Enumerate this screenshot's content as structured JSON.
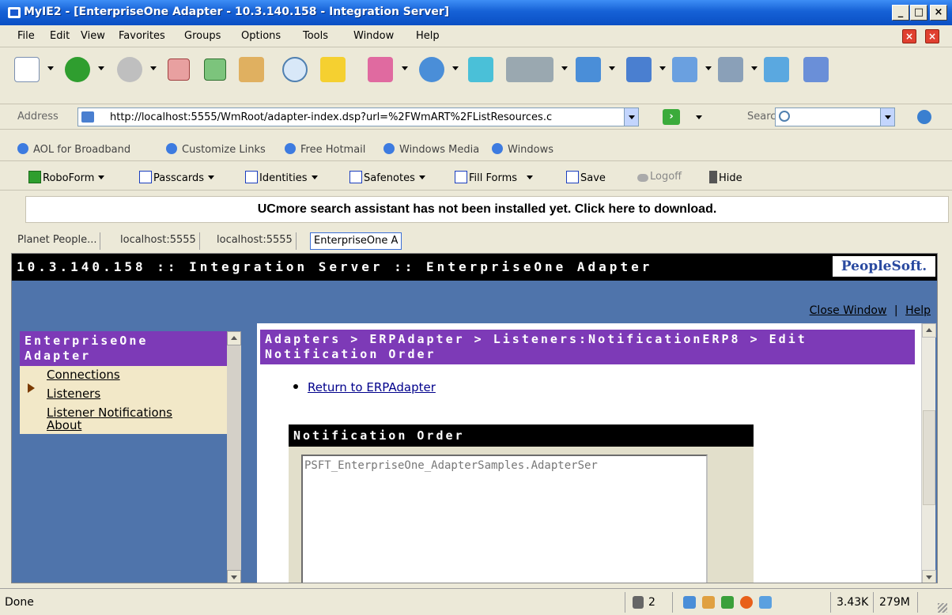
{
  "window": {
    "title": "MyIE2 - [EnterpriseOne Adapter - 10.3.140.158 - Integration Server]",
    "controls": [
      "_",
      "□",
      "×"
    ]
  },
  "menu": {
    "items": [
      "File",
      "Edit",
      "View",
      "Favorites",
      "Groups",
      "Options",
      "Tools",
      "Window",
      "Help"
    ]
  },
  "address": {
    "label": "Address",
    "url": "http://localhost:5555/WmRoot/adapter-index.dsp?url=%2FWmART%2FListResources.c"
  },
  "search": {
    "label": "Search"
  },
  "links": [
    "AOL for Broadband",
    "Customize Links",
    "Free Hotmail",
    "Windows Media",
    "Windows"
  ],
  "roboform": {
    "items": [
      "RoboForm",
      "Passcards",
      "Identities",
      "Safenotes",
      "Fill Forms",
      "Save",
      "Logoff",
      "Hide"
    ]
  },
  "ucmore": {
    "text": "UCmore search assistant has not been installed yet. Click here to download."
  },
  "tabs": [
    "Planet People...",
    "localhost:5555",
    "localhost:5555",
    "EnterpriseOne A"
  ],
  "page": {
    "header": "10.3.140.158 :: Integration Server :: EnterpriseOne Adapter",
    "logo": "PeopleSoft.",
    "close_window": "Close Window",
    "separator": "|",
    "help": "Help",
    "sidebar": {
      "title": "EnterpriseOne Adapter",
      "items": [
        "Connections",
        "Listeners",
        "Listener Notifications",
        "About"
      ]
    },
    "breadcrumb": "Adapters > ERPAdapter > Listeners:NotificationERP8 > Edit Notification Order",
    "return_link": "Return to ERPAdapter",
    "section_title": "Notification Order",
    "list_value": "PSFT_EnterpriseOne_AdapterSamples.AdapterSer"
  },
  "status": {
    "text": "Done",
    "count": "2",
    "size": "3.43K",
    "memory": "279M"
  }
}
